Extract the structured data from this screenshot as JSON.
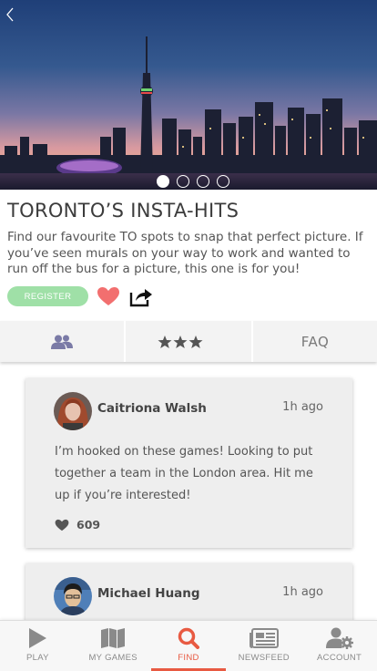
{
  "hero": {
    "slide_count": 4,
    "active_slide": 0
  },
  "event": {
    "title": "TORONTO’S INSTA-HITS",
    "description": "Find our favourite TO spots to snap that perfect picture. If you’ve seen murals on your way to work and wanted to run off the bus for a picture, this one is for you!",
    "register_label": "REGISTER"
  },
  "tabs": {
    "rating": 3.5,
    "faq_label": "FAQ"
  },
  "feed": {
    "posts": [
      {
        "author": "Caitriona Walsh",
        "time": "1h ago",
        "text": "I’m hooked on these games! Looking to put together a team in the London area. Hit me up if you’re interested!",
        "likes": "609"
      },
      {
        "author": "Michael Huang",
        "time": "1h ago"
      }
    ]
  },
  "nav": {
    "items": [
      {
        "label": "PLAY",
        "icon": "play-icon"
      },
      {
        "label": "MY GAMES",
        "icon": "map-icon"
      },
      {
        "label": "FIND",
        "icon": "search-icon"
      },
      {
        "label": "NEWSFEED",
        "icon": "newspaper-icon"
      },
      {
        "label": "ACCOUNT",
        "icon": "account-settings-icon"
      }
    ],
    "active_index": 2
  },
  "colors": {
    "accent": "#e85a42",
    "register": "#9fe0a7",
    "heart": "#f26f6f"
  }
}
